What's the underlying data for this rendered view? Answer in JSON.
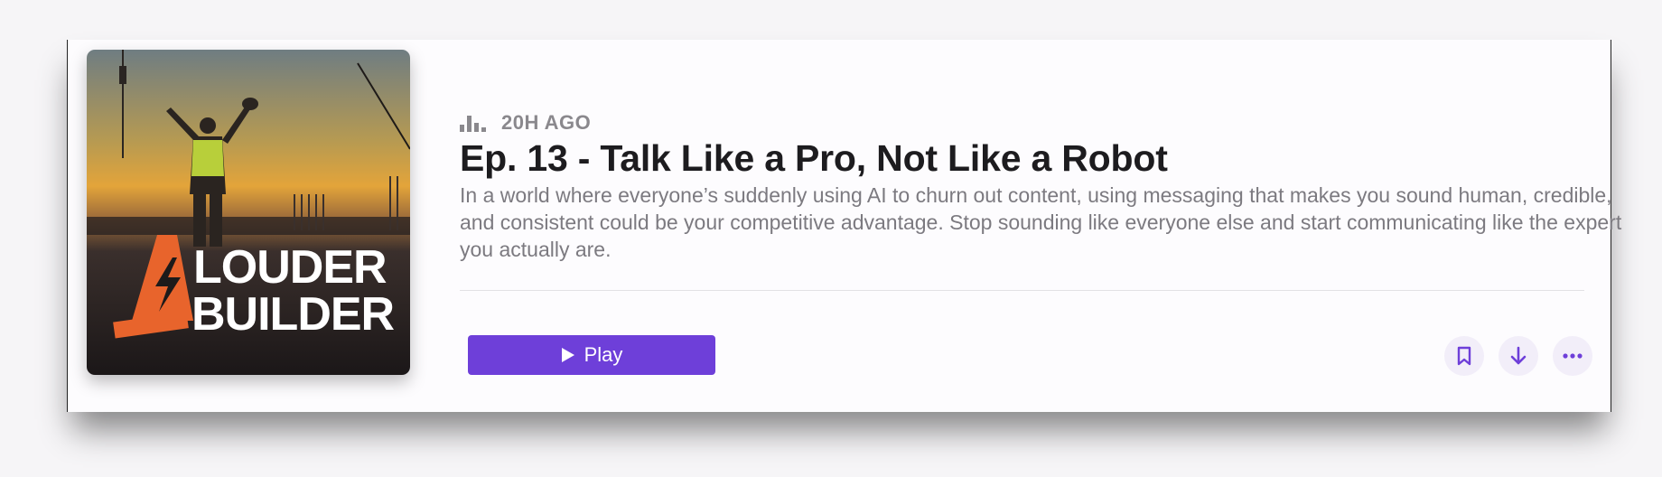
{
  "episode": {
    "meta_icon": "episode-bars-icon",
    "time_ago": "20H AGO",
    "title": "Ep. 13 - Talk Like a Pro, Not Like a Robot",
    "description": "In a world where everyone’s suddenly using AI to churn out content, using messaging that makes you sound human, credible, and consistent could be your competitive advantage. Stop sounding like everyone else and start communicating like the expert you actually are."
  },
  "artwork": {
    "line1": "LOUDER",
    "line2": "BUILDER",
    "accent": "#e8642c"
  },
  "actions": {
    "play_label": "Play",
    "bookmark_icon": "bookmark-icon",
    "download_icon": "download-arrow-icon",
    "more_icon": "more-ellipsis-icon"
  },
  "colors": {
    "accent": "#6e3fd9",
    "title": "#1d1c1f",
    "meta": "#8a888d"
  }
}
